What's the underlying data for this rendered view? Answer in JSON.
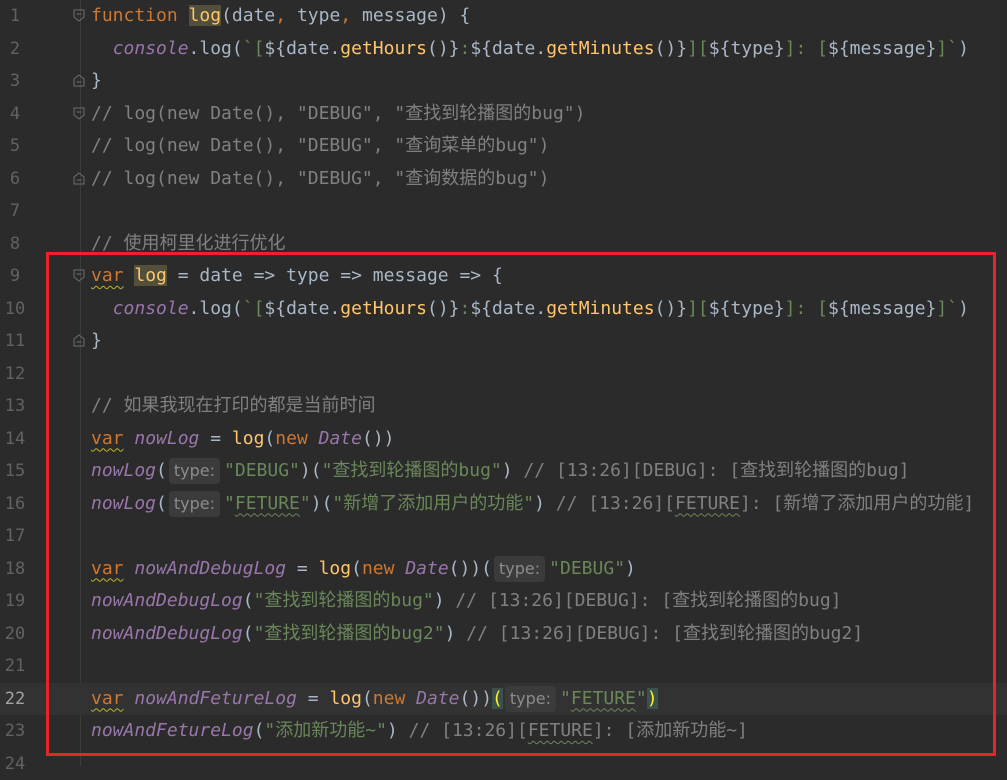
{
  "editor": {
    "lines": [
      {
        "n": "1",
        "parts": [
          [
            "kw",
            "function "
          ],
          [
            "fn hl",
            "log"
          ],
          [
            "id",
            "(date"
          ],
          [
            "kw",
            ", "
          ],
          [
            "id",
            "type"
          ],
          [
            "kw",
            ", "
          ],
          [
            "id",
            "message) {"
          ]
        ],
        "fold": "open"
      },
      {
        "n": "2",
        "parts": [
          [
            "id",
            "  "
          ],
          [
            "purple",
            "console"
          ],
          [
            "id",
            ".log("
          ],
          [
            "tpl",
            "`["
          ],
          [
            "id",
            "${date."
          ],
          [
            "fn",
            "getHours"
          ],
          [
            "id",
            "()}"
          ],
          [
            "tpl",
            ":"
          ],
          [
            "id",
            "${date."
          ],
          [
            "fn",
            "getMinutes"
          ],
          [
            "id",
            "()}"
          ],
          [
            "tpl",
            "]["
          ],
          [
            "id",
            "${type}"
          ],
          [
            "tpl",
            "]: ["
          ],
          [
            "id",
            "${message}"
          ],
          [
            "tpl",
            "]`"
          ],
          [
            "id",
            ")"
          ]
        ]
      },
      {
        "n": "3",
        "parts": [
          [
            "id",
            "}"
          ]
        ],
        "fold": "close"
      },
      {
        "n": "4",
        "parts": [
          [
            "cmt",
            "// log(new Date(), \"DEBUG\", \"查找到轮播图的bug\")"
          ]
        ],
        "fold": "open"
      },
      {
        "n": "5",
        "parts": [
          [
            "cmt",
            "// log(new Date(), \"DEBUG\", \"查询菜单的bug\")"
          ]
        ]
      },
      {
        "n": "6",
        "parts": [
          [
            "cmt",
            "// log(new Date(), \"DEBUG\", \"查询数据的bug\")"
          ]
        ],
        "fold": "close"
      },
      {
        "n": "7",
        "parts": []
      },
      {
        "n": "8",
        "parts": [
          [
            "cmt",
            "// 使用柯里化进行优化"
          ]
        ]
      },
      {
        "n": "9",
        "parts": [
          [
            "kw squig",
            "var"
          ],
          [
            "id",
            " "
          ],
          [
            "fn hl",
            "log"
          ],
          [
            "id",
            " = date => type => message => {"
          ]
        ],
        "fold": "open"
      },
      {
        "n": "10",
        "parts": [
          [
            "id",
            "  "
          ],
          [
            "purple",
            "console"
          ],
          [
            "id",
            ".log("
          ],
          [
            "tpl",
            "`["
          ],
          [
            "id",
            "${date."
          ],
          [
            "fn",
            "getHours"
          ],
          [
            "id",
            "()}"
          ],
          [
            "tpl",
            ":"
          ],
          [
            "id",
            "${date."
          ],
          [
            "fn",
            "getMinutes"
          ],
          [
            "id",
            "()}"
          ],
          [
            "tpl",
            "]["
          ],
          [
            "id",
            "${type}"
          ],
          [
            "tpl",
            "]: ["
          ],
          [
            "id",
            "${message}"
          ],
          [
            "tpl",
            "]`"
          ],
          [
            "id",
            ")"
          ]
        ]
      },
      {
        "n": "11",
        "parts": [
          [
            "id",
            "}"
          ]
        ],
        "fold": "close"
      },
      {
        "n": "12",
        "parts": []
      },
      {
        "n": "13",
        "parts": [
          [
            "cmt",
            "// 如果我现在打印的都是当前时间"
          ]
        ]
      },
      {
        "n": "14",
        "parts": [
          [
            "kw squig",
            "var"
          ],
          [
            "id",
            " "
          ],
          [
            "purple",
            "nowLog"
          ],
          [
            "id",
            " = "
          ],
          [
            "fn",
            "log"
          ],
          [
            "id",
            "("
          ],
          [
            "kw",
            "new "
          ],
          [
            "purple",
            "Date"
          ],
          [
            "id",
            "())"
          ]
        ]
      },
      {
        "n": "15",
        "parts": [
          [
            "purple",
            "nowLog"
          ],
          [
            "id",
            "("
          ],
          [
            "hint",
            "type:"
          ],
          [
            "str",
            "\"DEBUG\""
          ],
          [
            "id",
            ")("
          ],
          [
            "str",
            "\"查找到轮播图的bug\""
          ],
          [
            "id",
            ")"
          ],
          [
            "cmt",
            " // [13:26][DEBUG]: [查找到轮播图的bug]"
          ]
        ]
      },
      {
        "n": "16",
        "parts": [
          [
            "purple",
            "nowLog"
          ],
          [
            "id",
            "("
          ],
          [
            "hint",
            "type:"
          ],
          [
            "str",
            "\""
          ],
          [
            "str squig-g",
            "FETURE"
          ],
          [
            "str",
            "\""
          ],
          [
            "id",
            ")("
          ],
          [
            "str",
            "\"新增了添加用户的功能\""
          ],
          [
            "id",
            ")"
          ],
          [
            "cmt",
            " // [13:26]["
          ],
          [
            "cmt squig-g",
            "FETURE"
          ],
          [
            "cmt",
            "]: [新增了添加用户的功能]"
          ]
        ]
      },
      {
        "n": "17",
        "parts": []
      },
      {
        "n": "18",
        "parts": [
          [
            "kw squig",
            "var"
          ],
          [
            "id",
            " "
          ],
          [
            "purple",
            "nowAndDebugLog"
          ],
          [
            "id",
            " = "
          ],
          [
            "fn",
            "log"
          ],
          [
            "id",
            "("
          ],
          [
            "kw",
            "new "
          ],
          [
            "purple",
            "Date"
          ],
          [
            "id",
            "())("
          ],
          [
            "hint",
            "type:"
          ],
          [
            "str",
            "\"DEBUG\""
          ],
          [
            "id",
            ")"
          ]
        ]
      },
      {
        "n": "19",
        "parts": [
          [
            "purple",
            "nowAndDebugLog"
          ],
          [
            "id",
            "("
          ],
          [
            "str",
            "\"查找到轮播图的bug\""
          ],
          [
            "id",
            ")"
          ],
          [
            "cmt",
            " // [13:26][DEBUG]: [查找到轮播图的bug]"
          ]
        ]
      },
      {
        "n": "20",
        "parts": [
          [
            "purple",
            "nowAndDebugLog"
          ],
          [
            "id",
            "("
          ],
          [
            "str",
            "\"查找到轮播图的bug2\""
          ],
          [
            "id",
            ")"
          ],
          [
            "cmt",
            " // [13:26][DEBUG]: [查找到轮播图的bug2]"
          ]
        ]
      },
      {
        "n": "21",
        "parts": []
      },
      {
        "n": "22",
        "current": true,
        "parts": [
          [
            "kw squig",
            "var"
          ],
          [
            "id",
            " "
          ],
          [
            "purple",
            "nowAndFetureLog"
          ],
          [
            "id",
            " = "
          ],
          [
            "fn",
            "log"
          ],
          [
            "id",
            "("
          ],
          [
            "kw",
            "new "
          ],
          [
            "purple",
            "Date"
          ],
          [
            "id",
            "())"
          ],
          [
            "brace-match",
            "("
          ],
          [
            "hint",
            "type:"
          ],
          [
            "str",
            "\""
          ],
          [
            "str squig-g",
            "FETURE"
          ],
          [
            "str",
            "\""
          ],
          [
            "brace-match",
            ")"
          ]
        ]
      },
      {
        "n": "23",
        "parts": [
          [
            "purple",
            "nowAndFetureLog"
          ],
          [
            "id",
            "("
          ],
          [
            "str",
            "\"添加新功能~\""
          ],
          [
            "id",
            ")"
          ],
          [
            "cmt",
            " // [13:26]["
          ],
          [
            "cmt squig-g",
            "FETURE"
          ],
          [
            "cmt",
            "]: [添加新功能~]"
          ]
        ]
      },
      {
        "n": "24",
        "parts": []
      }
    ]
  },
  "annotation": {
    "color": "#e8232a",
    "label": "highlight-box"
  }
}
